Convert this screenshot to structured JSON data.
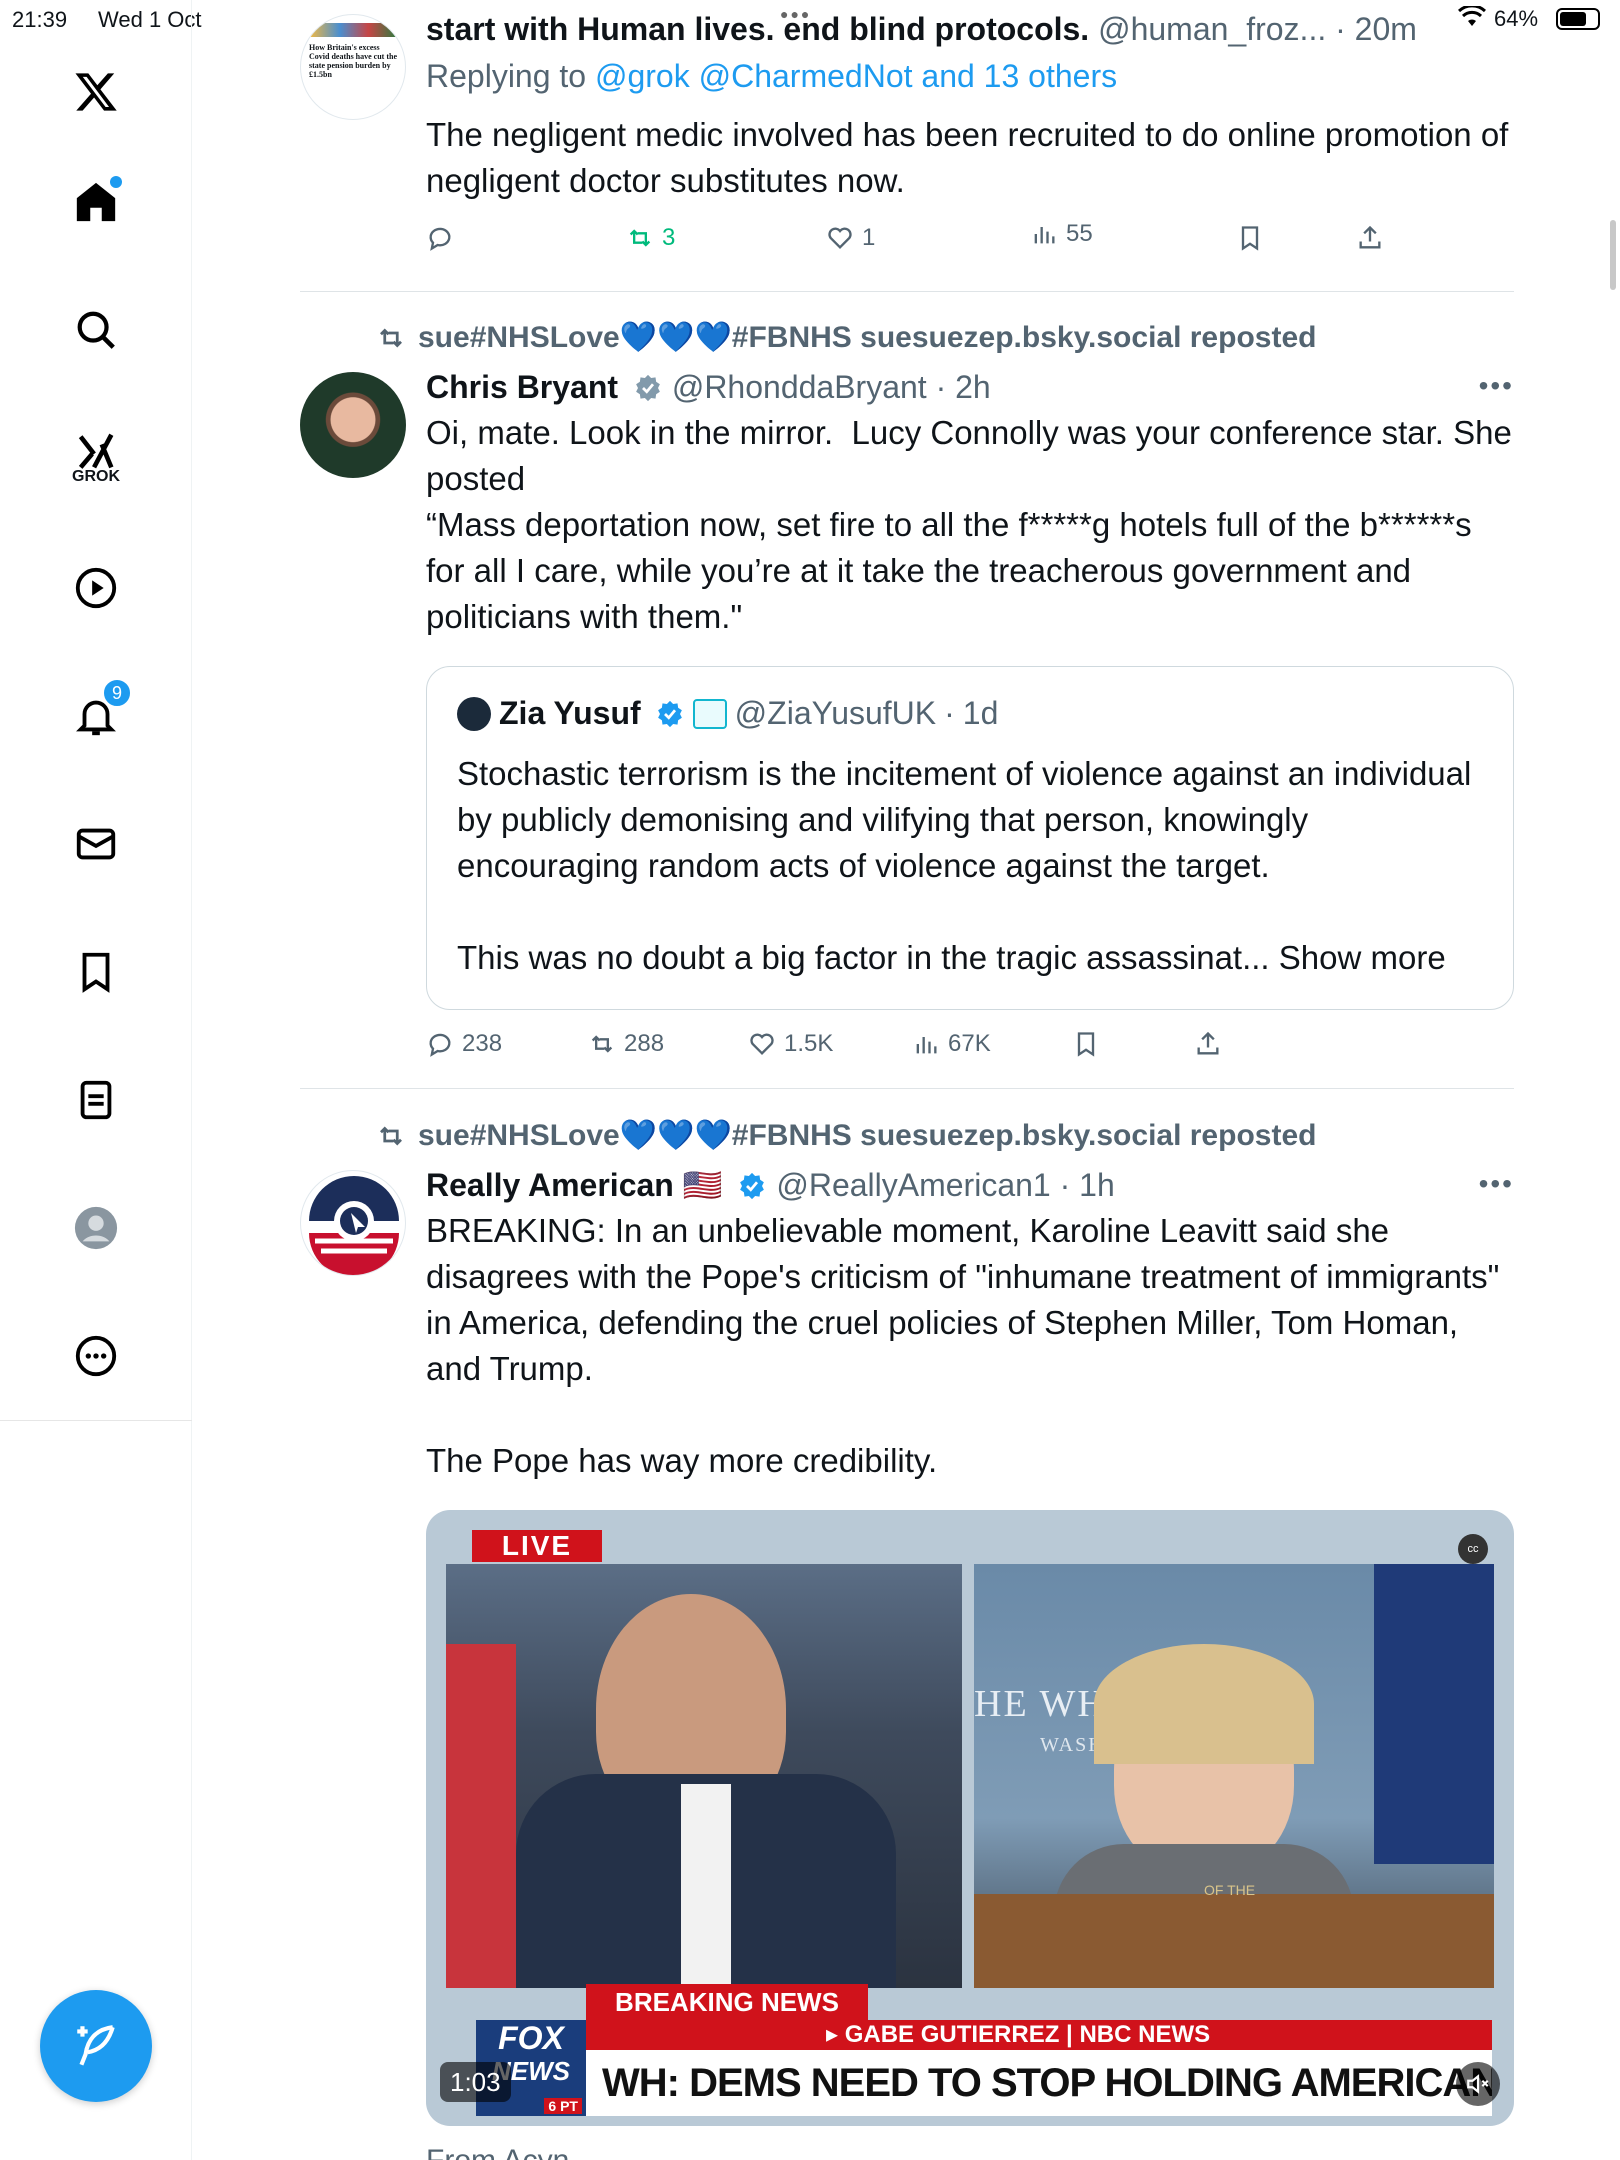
{
  "status_bar": {
    "time": "21:39",
    "date": "Wed 1 Oct",
    "battery": "64%"
  },
  "sidebar": {
    "items": [
      {
        "name": "x-logo"
      },
      {
        "name": "home"
      },
      {
        "name": "search"
      },
      {
        "name": "grok",
        "label": "GROK"
      },
      {
        "name": "video"
      },
      {
        "name": "notifications",
        "badge": "9"
      },
      {
        "name": "messages"
      },
      {
        "name": "bookmarks"
      },
      {
        "name": "lists"
      },
      {
        "name": "profile"
      },
      {
        "name": "more"
      }
    ]
  },
  "posts": [
    {
      "name_line": "start with Human lives. end blind protocols.",
      "handle": "@human_froz...",
      "time": "20m",
      "reply_prefix": "Replying to ",
      "reply_targets": "@grok @CharmedNot and 13 others",
      "text": "The negligent medic involved has been recruited to do online promotion of negligent doctor substitutes now.",
      "avatar_caption": "How Britain's excess Covid deaths have cut the state pension burden by £1.5bn",
      "stats": {
        "replies": "",
        "reposts": "3",
        "likes": "1",
        "views": "55"
      }
    },
    {
      "repost_by": "sue#NHSLove💙💙💙#FBNHS suesuezep.bsky.social reposted",
      "name": "Chris Bryant",
      "handle": "@RhonddaBryant",
      "time": "2h",
      "text": "Oi, mate. Look in the mirror.  Lucy Connolly was your conference star. She posted\n“Mass deportation now, set fire to all the f*****g hotels full of the b******s for all I care, while you’re at it take the treacherous government and politicians with them.\"",
      "quote": {
        "name": "Zia Yusuf",
        "handle": "@ZiaYusufUK",
        "time": "1d",
        "text": "Stochastic terrorism is the incitement of violence against an individual by publicly demonising and vilifying that person, knowingly encouraging random acts of violence against the target.\n\nThis was no doubt a big factor in the tragic assassinat...",
        "show_more": "Show more"
      },
      "stats": {
        "replies": "238",
        "reposts": "288",
        "likes": "1.5K",
        "views": "67K"
      }
    },
    {
      "repost_by": "sue#NHSLove💙💙💙#FBNHS suesuezep.bsky.social reposted",
      "name": "Really American",
      "flag": "🇺🇸",
      "handle": "@ReallyAmerican1",
      "time": "1h",
      "text": "BREAKING: In an unbelievable moment, Karoline Leavitt said she disagrees with the Pope's criticism of \"inhumane treatment of immigrants\" in America, defending the cruel policies of Stephen Miller, Tom Homan, and Trump.\n\nThe Pope has way more credibility.",
      "video": {
        "live": "LIVE",
        "breaking": "BREAKING NEWS",
        "reporter": "▸ GABE GUTIERREZ | NBC NEWS",
        "headline": "WH: DEMS NEED TO STOP HOLDING AMERICANS HOSTAGE",
        "fox": "FOX",
        "news": "NEWS",
        "clock": "6 PT",
        "duration": "1:03",
        "podium_text": "HE WHIT",
        "podium_sub": "WASHIN",
        "seal_text": "OF THE"
      },
      "next_text": "From Acyn"
    }
  ],
  "colors": {
    "accent": "#1d9bf0",
    "muted": "#536471",
    "repost_green": "#00ba7c",
    "fox_red": "#d0121b"
  }
}
